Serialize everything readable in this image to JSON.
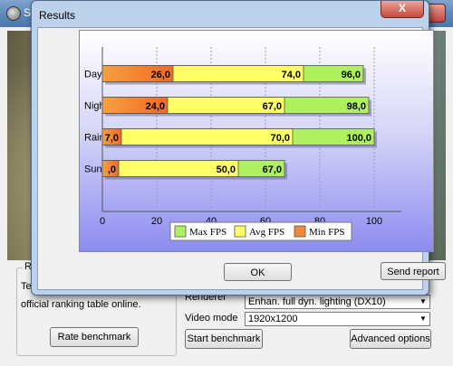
{
  "background_window": {
    "title": "S",
    "close_glyph": "X",
    "ranking_group_label": "Ra",
    "ranking_text_line1": "Tes",
    "ranking_text_line2": "official ranking table online.",
    "rate_benchmark_label": "Rate benchmark",
    "renderer_label": "Renderer",
    "renderer_value": "Enhan. full dyn. lighting (DX10)",
    "video_mode_label": "Video mode",
    "video_mode_value": "1920x1200",
    "start_benchmark_label": "Start benchmark",
    "advanced_options_label": "Advanced options"
  },
  "dialog": {
    "title": "Results",
    "close_glyph": "X",
    "ok_label": "OK",
    "send_report_label": "Send report"
  },
  "colors": {
    "max_fps": "#aef060",
    "avg_fps": "#ffff66",
    "min_fps": "#ee8a3a",
    "chart_bottom": "#8c8cf0"
  },
  "chart_data": {
    "type": "bar",
    "orientation": "horizontal",
    "stacking": "overlapping",
    "categories": [
      "Day",
      "Night",
      "Rain",
      "SunShafts"
    ],
    "series": [
      {
        "name": "Max FPS",
        "values": [
          96.0,
          98.0,
          100.0,
          67.0
        ],
        "labels": [
          "96,0",
          "98,0",
          "100,0",
          "67,0"
        ]
      },
      {
        "name": "Avg FPS",
        "values": [
          74.0,
          67.0,
          70.0,
          50.0
        ],
        "labels": [
          "74,0",
          "67,0",
          "70,0",
          "50,0"
        ]
      },
      {
        "name": "Min FPS",
        "values": [
          26.0,
          24.0,
          7.0,
          6.0
        ],
        "labels": [
          "26,0",
          "24,0",
          "7,0",
          ",0"
        ]
      }
    ],
    "xlim": [
      0,
      110
    ],
    "xticks": [
      "0",
      "20",
      "40",
      "60",
      "80",
      "100"
    ],
    "xtick_values": [
      0,
      20,
      40,
      60,
      80,
      100
    ],
    "grid": "vertical",
    "legend": "bottom"
  }
}
